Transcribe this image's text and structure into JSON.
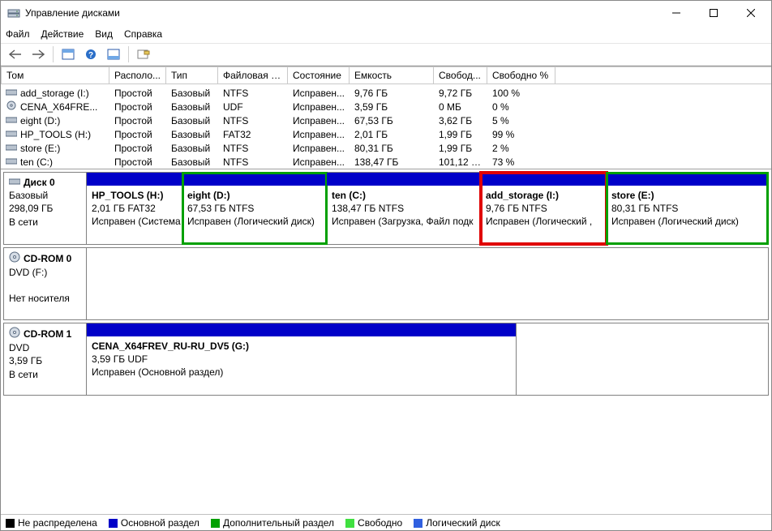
{
  "window": {
    "title": "Управление дисками"
  },
  "menu": {
    "file": "Файл",
    "action": "Действие",
    "view": "Вид",
    "help": "Справка"
  },
  "columns": {
    "volume": "Том",
    "layout": "Располо...",
    "type": "Тип",
    "fs": "Файловая с...",
    "status": "Состояние",
    "capacity": "Емкость",
    "free": "Свобод...",
    "freepct": "Свободно %"
  },
  "vols": [
    {
      "name": "add_storage (I:)",
      "layout": "Простой",
      "type": "Базовый",
      "fs": "NTFS",
      "status": "Исправен...",
      "cap": "9,76 ГБ",
      "free": "9,72 ГБ",
      "pct": "100 %"
    },
    {
      "name": "CENA_X64FRE...",
      "layout": "Простой",
      "type": "Базовый",
      "fs": "UDF",
      "status": "Исправен...",
      "cap": "3,59 ГБ",
      "free": "0 МБ",
      "pct": "0 %",
      "icon": "cd"
    },
    {
      "name": "eight (D:)",
      "layout": "Простой",
      "type": "Базовый",
      "fs": "NTFS",
      "status": "Исправен...",
      "cap": "67,53 ГБ",
      "free": "3,62 ГБ",
      "pct": "5 %"
    },
    {
      "name": "HP_TOOLS (H:)",
      "layout": "Простой",
      "type": "Базовый",
      "fs": "FAT32",
      "status": "Исправен...",
      "cap": "2,01 ГБ",
      "free": "1,99 ГБ",
      "pct": "99 %"
    },
    {
      "name": "store (E:)",
      "layout": "Простой",
      "type": "Базовый",
      "fs": "NTFS",
      "status": "Исправен...",
      "cap": "80,31 ГБ",
      "free": "1,99 ГБ",
      "pct": "2 %"
    },
    {
      "name": "ten (C:)",
      "layout": "Простой",
      "type": "Базовый",
      "fs": "NTFS",
      "status": "Исправен...",
      "cap": "138,47 ГБ",
      "free": "101,12 ГБ",
      "pct": "73 %"
    }
  ],
  "disk0": {
    "title": "Диск 0",
    "type": "Базовый",
    "size": "298,09 ГБ",
    "state": "В сети",
    "p1": {
      "name": "HP_TOOLS  (H:)",
      "info": "2,01 ГБ FAT32",
      "status": "Исправен (Система"
    },
    "p2": {
      "name": "eight  (D:)",
      "info": "67,53 ГБ NTFS",
      "status": "Исправен (Логический диск)"
    },
    "p3": {
      "name": "ten  (C:)",
      "info": "138,47 ГБ NTFS",
      "status": "Исправен (Загрузка, Файл подк"
    },
    "p4": {
      "name": "add_storage  (I:)",
      "info": "9,76 ГБ NTFS",
      "status": "Исправен (Логический ,"
    },
    "p5": {
      "name": "store  (E:)",
      "info": "80,31 ГБ NTFS",
      "status": "Исправен (Логический диск)"
    }
  },
  "cd0": {
    "title": "CD-ROM 0",
    "type": "DVD (F:)",
    "nomedia": "Нет носителя"
  },
  "cd1": {
    "title": "CD-ROM 1",
    "type": "DVD",
    "size": "3,59 ГБ",
    "state": "В сети",
    "p1": {
      "name": "CENA_X64FREV_RU-RU_DV5  (G:)",
      "info": "3,59 ГБ UDF",
      "status": "Исправен (Основной раздел)"
    }
  },
  "legend": {
    "unalloc": "Не распределена",
    "primary": "Основной раздел",
    "extended": "Дополнительный раздел",
    "free": "Свободно",
    "logical": "Логический диск"
  }
}
